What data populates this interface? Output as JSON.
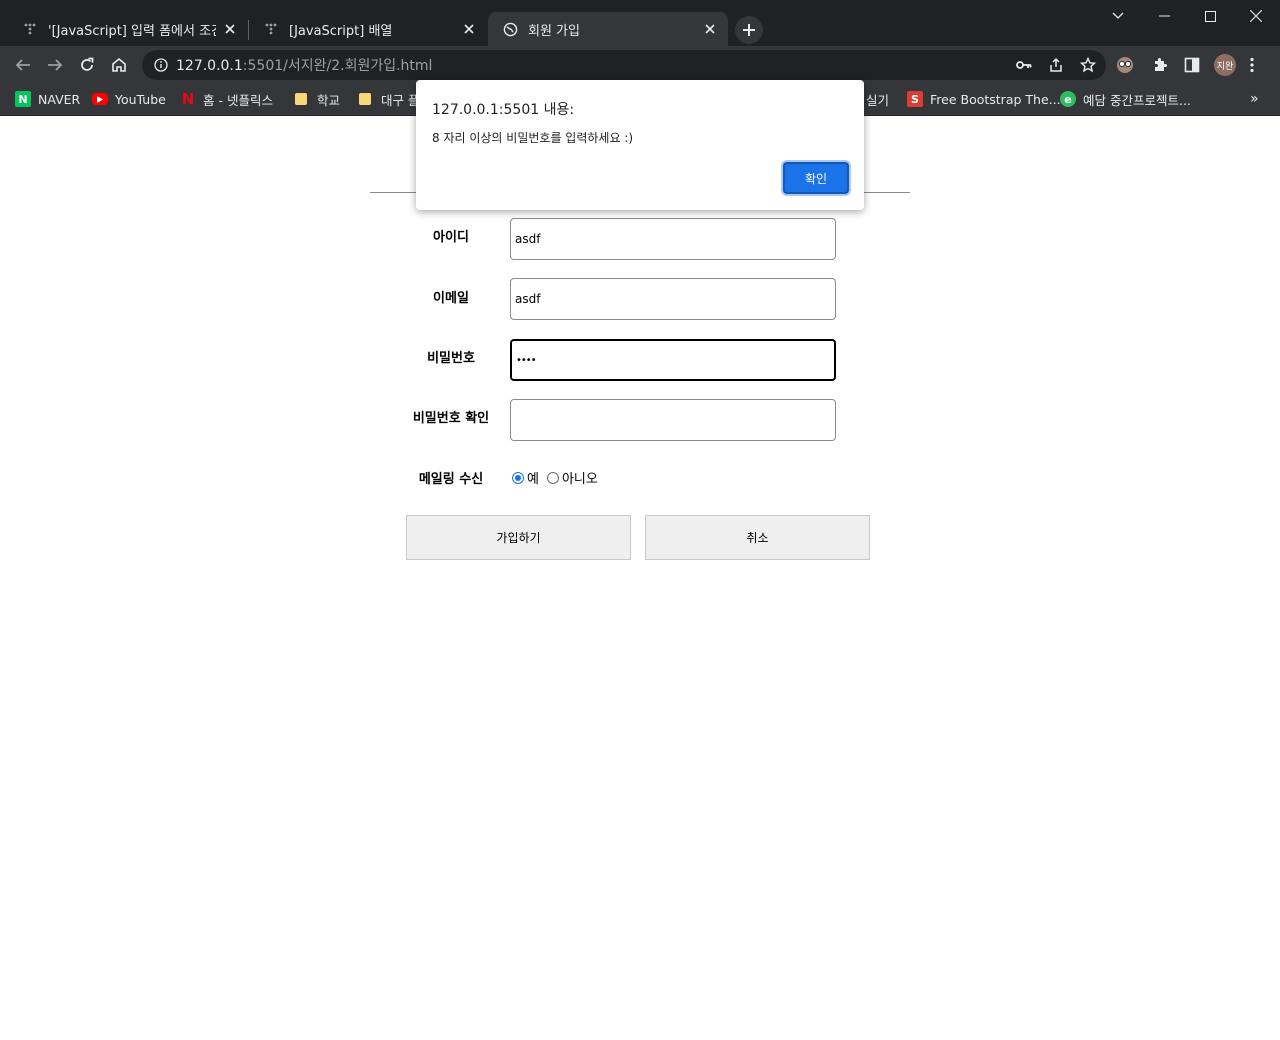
{
  "tabs": [
    {
      "title": "'[JavaScript] 입력 폼에서 조건 체",
      "favicon": "tistory-dots-icon"
    },
    {
      "title": "[JavaScript] 배열",
      "favicon": "tistory-dots-icon"
    },
    {
      "title": "회원 가입",
      "favicon": "globe-icon"
    }
  ],
  "address_bar": {
    "host": "127.0.0.1",
    "rest": ":5501/서지완/2.회원가입.html"
  },
  "profile": {
    "initials": "지완"
  },
  "bookmarks": [
    {
      "label": "NAVER",
      "icon": "naver-icon",
      "color": "#03c75a"
    },
    {
      "label": "YouTube",
      "icon": "youtube-icon",
      "color": "#ff0000"
    },
    {
      "label": "홈 - 넷플릭스",
      "icon": "netflix-icon",
      "color": "#e50914"
    },
    {
      "label": "학교",
      "icon": "folder-icon"
    },
    {
      "label": "대구 플",
      "icon": "folder-icon"
    },
    {
      "label": "실기",
      "icon": "folder-icon"
    },
    {
      "label": "Free Bootstrap The...",
      "icon": "startbootstrap-icon",
      "color": "#dd3d31"
    },
    {
      "label": "예담 중간프로젝트...",
      "icon": "evernote-icon",
      "color": "#2dbe60"
    }
  ],
  "form": {
    "id_label": "아이디",
    "id_value": "asdf",
    "email_label": "이메일",
    "email_value": "asdf",
    "password_label": "비밀번호",
    "password_value": "••••",
    "password_confirm_label": "비밀번호 확인",
    "password_confirm_value": "",
    "mailing_label": "메일링 수신",
    "mailing_yes": "예",
    "mailing_no": "아니오",
    "submit_label": "가입하기",
    "cancel_label": "취소"
  },
  "dialog": {
    "title": "127.0.0.1:5501 내용:",
    "message": "8 자리 이상의 비밀번호를 입력하세요 :)",
    "ok_label": "확인"
  },
  "colors": {
    "chrome_dark": "#202124",
    "chrome_toolbar": "#35363a",
    "accent": "#1a73e8"
  }
}
